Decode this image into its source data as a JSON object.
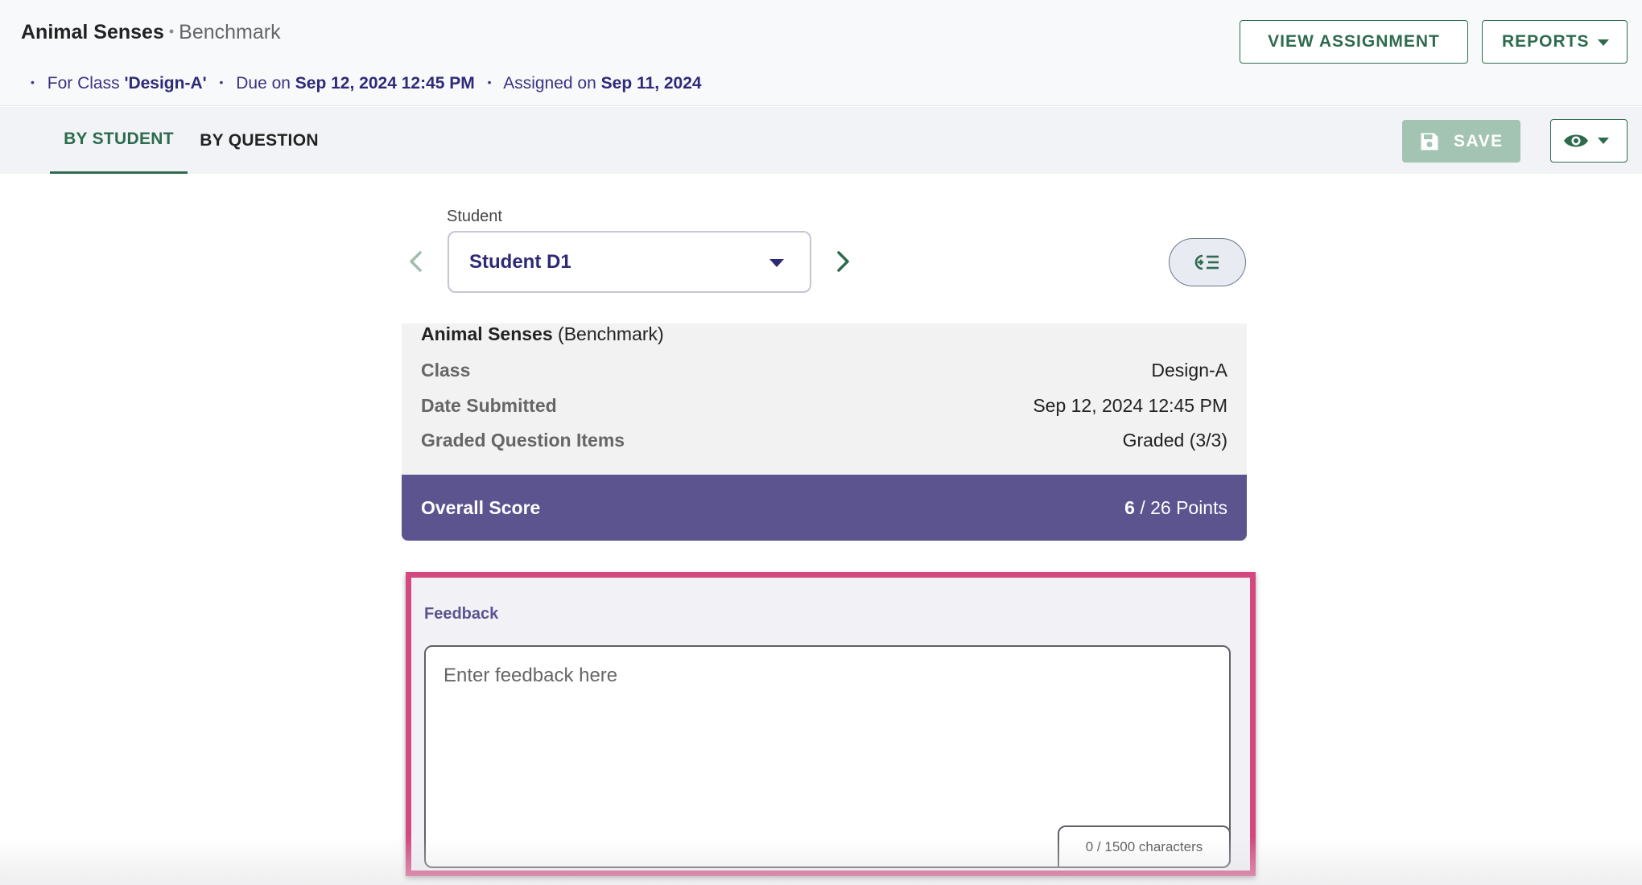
{
  "header": {
    "title": "Animal Senses",
    "subtitle": "Benchmark",
    "meta": {
      "class_prefix": "For Class",
      "class_name": "'Design-A'",
      "due_prefix": "Due on",
      "due_date": "Sep 12, 2024 12:45 PM",
      "assigned_prefix": "Assigned on",
      "assigned_date": "Sep 11, 2024"
    },
    "view_assignment_label": "VIEW ASSIGNMENT",
    "reports_label": "REPORTS"
  },
  "tabs": [
    {
      "label": "BY STUDENT",
      "active": true
    },
    {
      "label": "BY QUESTION",
      "active": false
    }
  ],
  "toolbar": {
    "save_label": "SAVE",
    "save_icon": "floppy-disk-icon",
    "view_icon": "eye-icon"
  },
  "student_selector": {
    "label": "Student",
    "selected": "Student D1"
  },
  "summary": {
    "title": "Animal Senses",
    "title_tag": "(Benchmark)",
    "rows": [
      {
        "key": "Class",
        "value": "Design-A"
      },
      {
        "key": "Date Submitted",
        "value": "Sep 12, 2024 12:45 PM"
      },
      {
        "key": "Graded Question Items",
        "value": "Graded (3/3)"
      }
    ],
    "score_label": "Overall Score",
    "score_value": "6",
    "score_total": "/ 26 Points"
  },
  "feedback": {
    "label": "Feedback",
    "placeholder": "Enter feedback here",
    "char_count": "0 / 1500 characters"
  },
  "colors": {
    "accent_green": "#2e6b4e",
    "accent_purple": "#5b548e",
    "highlight_pink": "#d3497f"
  }
}
